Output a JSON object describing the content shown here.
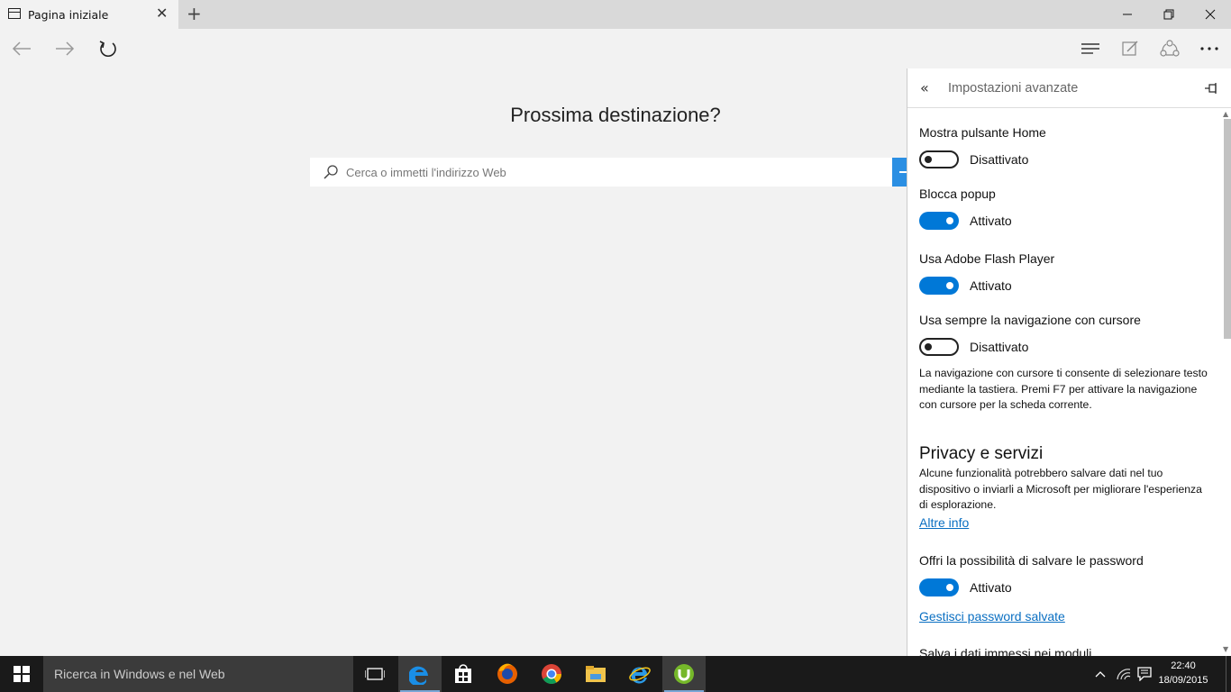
{
  "browser": {
    "tab_title": "Pagina iniziale",
    "new_tab_icon": "plus-icon",
    "window_controls": [
      "minimize-icon",
      "restore-icon",
      "close-icon"
    ]
  },
  "nav": {
    "icons": [
      "back-icon",
      "forward-icon",
      "refresh-icon",
      "hub-icon",
      "web-note-icon",
      "share-icon",
      "more-icon"
    ]
  },
  "main": {
    "title": "Prossima destinazione?",
    "search_placeholder": "Cerca o immetti l'indirizzo Web"
  },
  "panel": {
    "title": "Impostazioni avanzate",
    "settings": [
      {
        "label": "Mostra pulsante Home",
        "state": "Disattivato",
        "on": false
      },
      {
        "label": "Blocca popup",
        "state": "Attivato",
        "on": true
      },
      {
        "label": "Usa Adobe Flash Player",
        "state": "Attivato",
        "on": true
      },
      {
        "label": "Usa sempre la navigazione con cursore",
        "state": "Disattivato",
        "on": false
      }
    ],
    "caret_description": "La navigazione con cursore ti consente di selezionare testo mediante la tastiera. Premi F7 per attivare la navigazione con cursore per la scheda corrente.",
    "privacy": {
      "title": "Privacy e servizi",
      "description": "Alcune funzionalità potrebbero salvare dati nel tuo dispositivo o inviarli a Microsoft per migliorare l'esperienza di esplorazione.",
      "more_info": "Altre info",
      "password_label": "Offri la possibilità di salvare le password",
      "password_state": "Attivato",
      "password_on": true,
      "manage_passwords": "Gestisci password salvate",
      "form_entries": "Salva i dati immessi nei moduli"
    }
  },
  "taskbar": {
    "search_text": "Ricerca in Windows e nel Web",
    "apps": [
      "task-view-icon",
      "edge-icon",
      "store-icon",
      "firefox-icon",
      "chrome-icon",
      "file-explorer-icon",
      "internet-explorer-icon",
      "utorrent-icon"
    ],
    "time": "22:40",
    "date": "18/09/2015"
  },
  "colors": {
    "accent": "#0078d7",
    "link": "#0a6fc2",
    "taskbar": "#1a1a1a"
  }
}
